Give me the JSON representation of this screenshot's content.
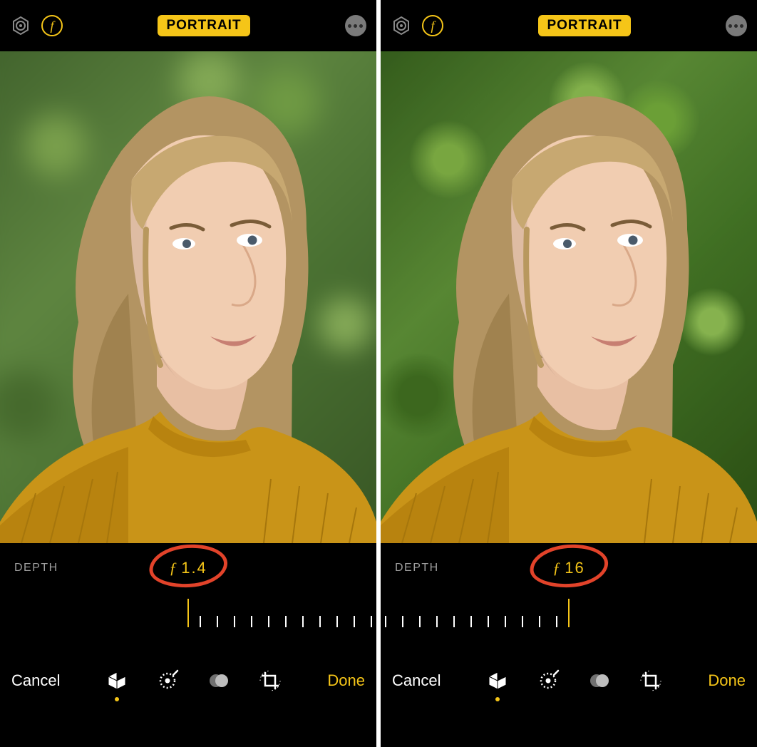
{
  "left": {
    "mode": "PORTRAIT",
    "depth_label": "DEPTH",
    "f_value": "1.4",
    "cancel": "Cancel",
    "done": "Done",
    "slider_position": "left",
    "background": "blurred"
  },
  "right": {
    "mode": "PORTRAIT",
    "depth_label": "DEPTH",
    "f_value": "16",
    "cancel": "Cancel",
    "done": "Done",
    "slider_position": "right",
    "background": "sharp"
  },
  "icons": {
    "live_photo": "live-photo-icon",
    "aperture": "aperture-icon",
    "more": "more-icon",
    "portrait_tool": "portrait-cube-icon",
    "adjust_tool": "adjust-dial-icon",
    "filters_tool": "filters-circles-icon",
    "crop_tool": "crop-rotate-icon"
  },
  "colors": {
    "accent": "#f5c518",
    "annotation": "#e2432a",
    "label_gray": "#9f9f9f"
  }
}
